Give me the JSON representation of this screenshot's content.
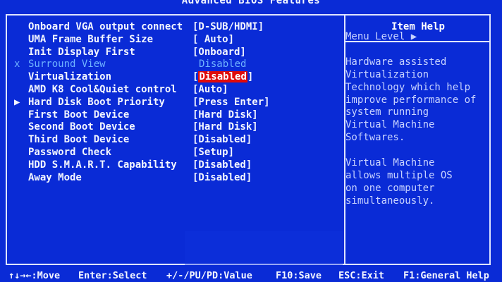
{
  "title": "Advanced BIOS Features",
  "settings": [
    {
      "label": "Onboard VGA output connect",
      "value": "[D-SUB/HDMI]",
      "marker": "",
      "state": "normal"
    },
    {
      "label": "UMA Frame Buffer Size",
      "value": "[  Auto]",
      "marker": "",
      "state": "normal"
    },
    {
      "label": "Init Display First",
      "value": "[Onboard]",
      "marker": "",
      "state": "normal"
    },
    {
      "label": "Surround View",
      "value": "Disabled",
      "marker": "x",
      "state": "disabled"
    },
    {
      "label": "Virtualization",
      "value": "Disabled",
      "marker": "",
      "state": "selected"
    },
    {
      "label": "AMD K8 Cool&Quiet control",
      "value": "[Auto]",
      "marker": "",
      "state": "normal"
    },
    {
      "label": "Hard Disk Boot Priority",
      "value": "[Press Enter]",
      "marker": "▶",
      "state": "normal"
    },
    {
      "label": "First Boot Device",
      "value": "[Hard Disk]",
      "marker": "",
      "state": "normal"
    },
    {
      "label": "Second Boot Device",
      "value": "[Hard Disk]",
      "marker": "",
      "state": "normal"
    },
    {
      "label": "Third Boot Device",
      "value": "[Disabled]",
      "marker": "",
      "state": "normal"
    },
    {
      "label": "Password Check",
      "value": "[Setup]",
      "marker": "",
      "state": "normal"
    },
    {
      "label": "HDD S.M.A.R.T. Capability",
      "value": "[Disabled]",
      "marker": "",
      "state": "normal"
    },
    {
      "label": "Away Mode",
      "value": "[Disabled]",
      "marker": "",
      "state": "normal"
    }
  ],
  "help": {
    "title": "Item Help",
    "menu_level": "Menu Level   ▶",
    "lines": [
      "Hardware assisted",
      "Virtualization",
      "Technology which help",
      "improve performance of",
      "system running",
      "Virtual Machine",
      "Softwares.",
      "",
      "Virtual Machine",
      "allows multiple OS",
      "on one computer",
      "simultaneously."
    ]
  },
  "footer": [
    {
      "key": "↑↓→←:Move"
    },
    {
      "key": "Enter:Select"
    },
    {
      "key": "+/-/PU/PD:Value"
    },
    {
      "key": "F10:Save"
    },
    {
      "key": "ESC:Exit"
    },
    {
      "key": "F1:General Help"
    }
  ],
  "colors": {
    "background": "#0a2bd6",
    "highlight": "#e00a0a",
    "disabled_text": "#6fb3ff"
  }
}
